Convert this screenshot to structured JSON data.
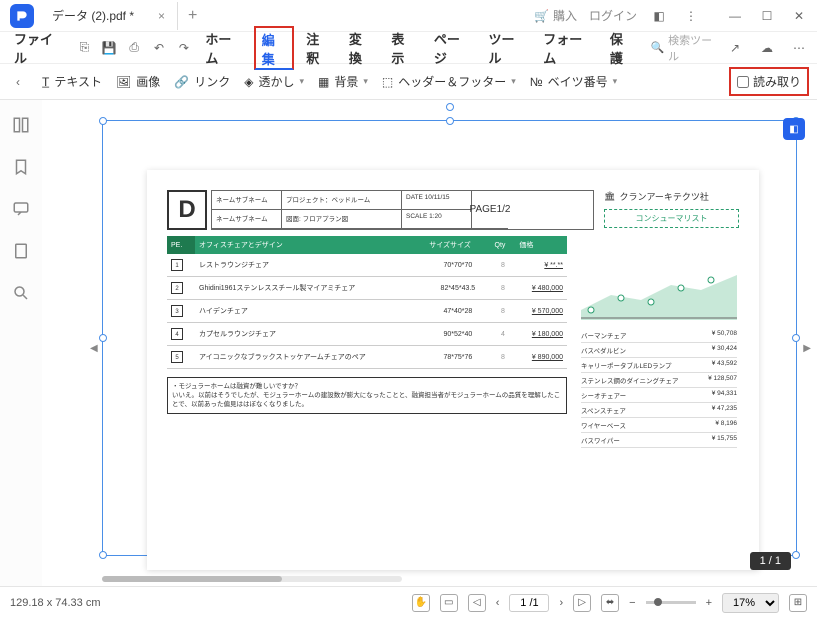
{
  "titlebar": {
    "tab_name": "データ (2).pdf *",
    "purchase": "購入",
    "login": "ログイン"
  },
  "menubar": {
    "file": "ファイル",
    "items": [
      "ホーム",
      "編集",
      "注釈",
      "変換",
      "表示",
      "ページ",
      "ツール",
      "フォーム",
      "保護"
    ],
    "search_placeholder": "検索ツール"
  },
  "toolbar": {
    "text": "テキスト",
    "image": "画像",
    "link": "リンク",
    "watermark": "透かし",
    "background": "背景",
    "header_footer": "ヘッダー＆フッター",
    "bates": "ベイツ番号",
    "readonly": "読み取り"
  },
  "doc": {
    "logo": "D",
    "h1": "ネームサブネーム",
    "h2": "プロジェクト：ベッドルーム",
    "h3": "DATE 10/11/15",
    "h4": "PAGE",
    "h5": "ネームサブネーム",
    "h6": "図面: フロアプラン図 ",
    "h7": "SCALE 1:20",
    "h8": "1/2",
    "company": "クランアーキテクツ社",
    "consumer": "コンシューマリスト",
    "th_pe": "PE.",
    "th_name": "オフィスチェアとデザイン",
    "th_size": "サイズサイズ",
    "th_qty": "Qty",
    "th_price": "価格",
    "rows": [
      {
        "n": "1",
        "name": "レストラウンジチェア",
        "size": "70*70*70",
        "qty": "8",
        "price": "¥ **.**"
      },
      {
        "n": "2",
        "name": "Ghidini1961ステンレススチール製マイアミチェア",
        "size": "82*45*43.5",
        "qty": "8",
        "price": "¥ 480,000"
      },
      {
        "n": "3",
        "name": "ハイデンチェア",
        "size": "47*40*28",
        "qty": "8",
        "price": "¥ 570,000"
      },
      {
        "n": "4",
        "name": "カプセルラウンジチェア",
        "size": "90*52*40",
        "qty": "4",
        "price": "¥ 180,000"
      },
      {
        "n": "5",
        "name": "アイコニックなブラックストッケアームチェアのペア",
        "size": "78*75*76",
        "qty": "8",
        "price": "¥ 890,000"
      }
    ],
    "note_title": "・モジュラーホームは融資が難しいですか？",
    "note_body": "いいえ。以前はそうでしたが、モジュラーホームの建設数が膨大になったことと、融資担当者がモジュラーホームの品質を理解したことで、以前あった偏見ははぼなくなりました。",
    "side": [
      {
        "n": "バーマンチェア",
        "p": "¥ 50,708"
      },
      {
        "n": "バスペダルビン",
        "p": "¥ 30,424"
      },
      {
        "n": "キャリーポータブルLEDランプ",
        "p": "¥ 43,592"
      },
      {
        "n": "ステンレス鋼のダイニングチェア",
        "p": "¥ 128,507"
      },
      {
        "n": "シーオチェアー",
        "p": "¥ 94,331"
      },
      {
        "n": "スペンスチェア",
        "p": "¥ 47,235"
      },
      {
        "n": "ワイヤーベース",
        "p": "¥ 8,196"
      },
      {
        "n": "バスワイパー",
        "p": "¥ 15,755"
      }
    ]
  },
  "pager": "1 / 1",
  "statusbar": {
    "dims": "129.18 x 74.33 cm",
    "page": "1 /1",
    "zoom": "17%"
  }
}
